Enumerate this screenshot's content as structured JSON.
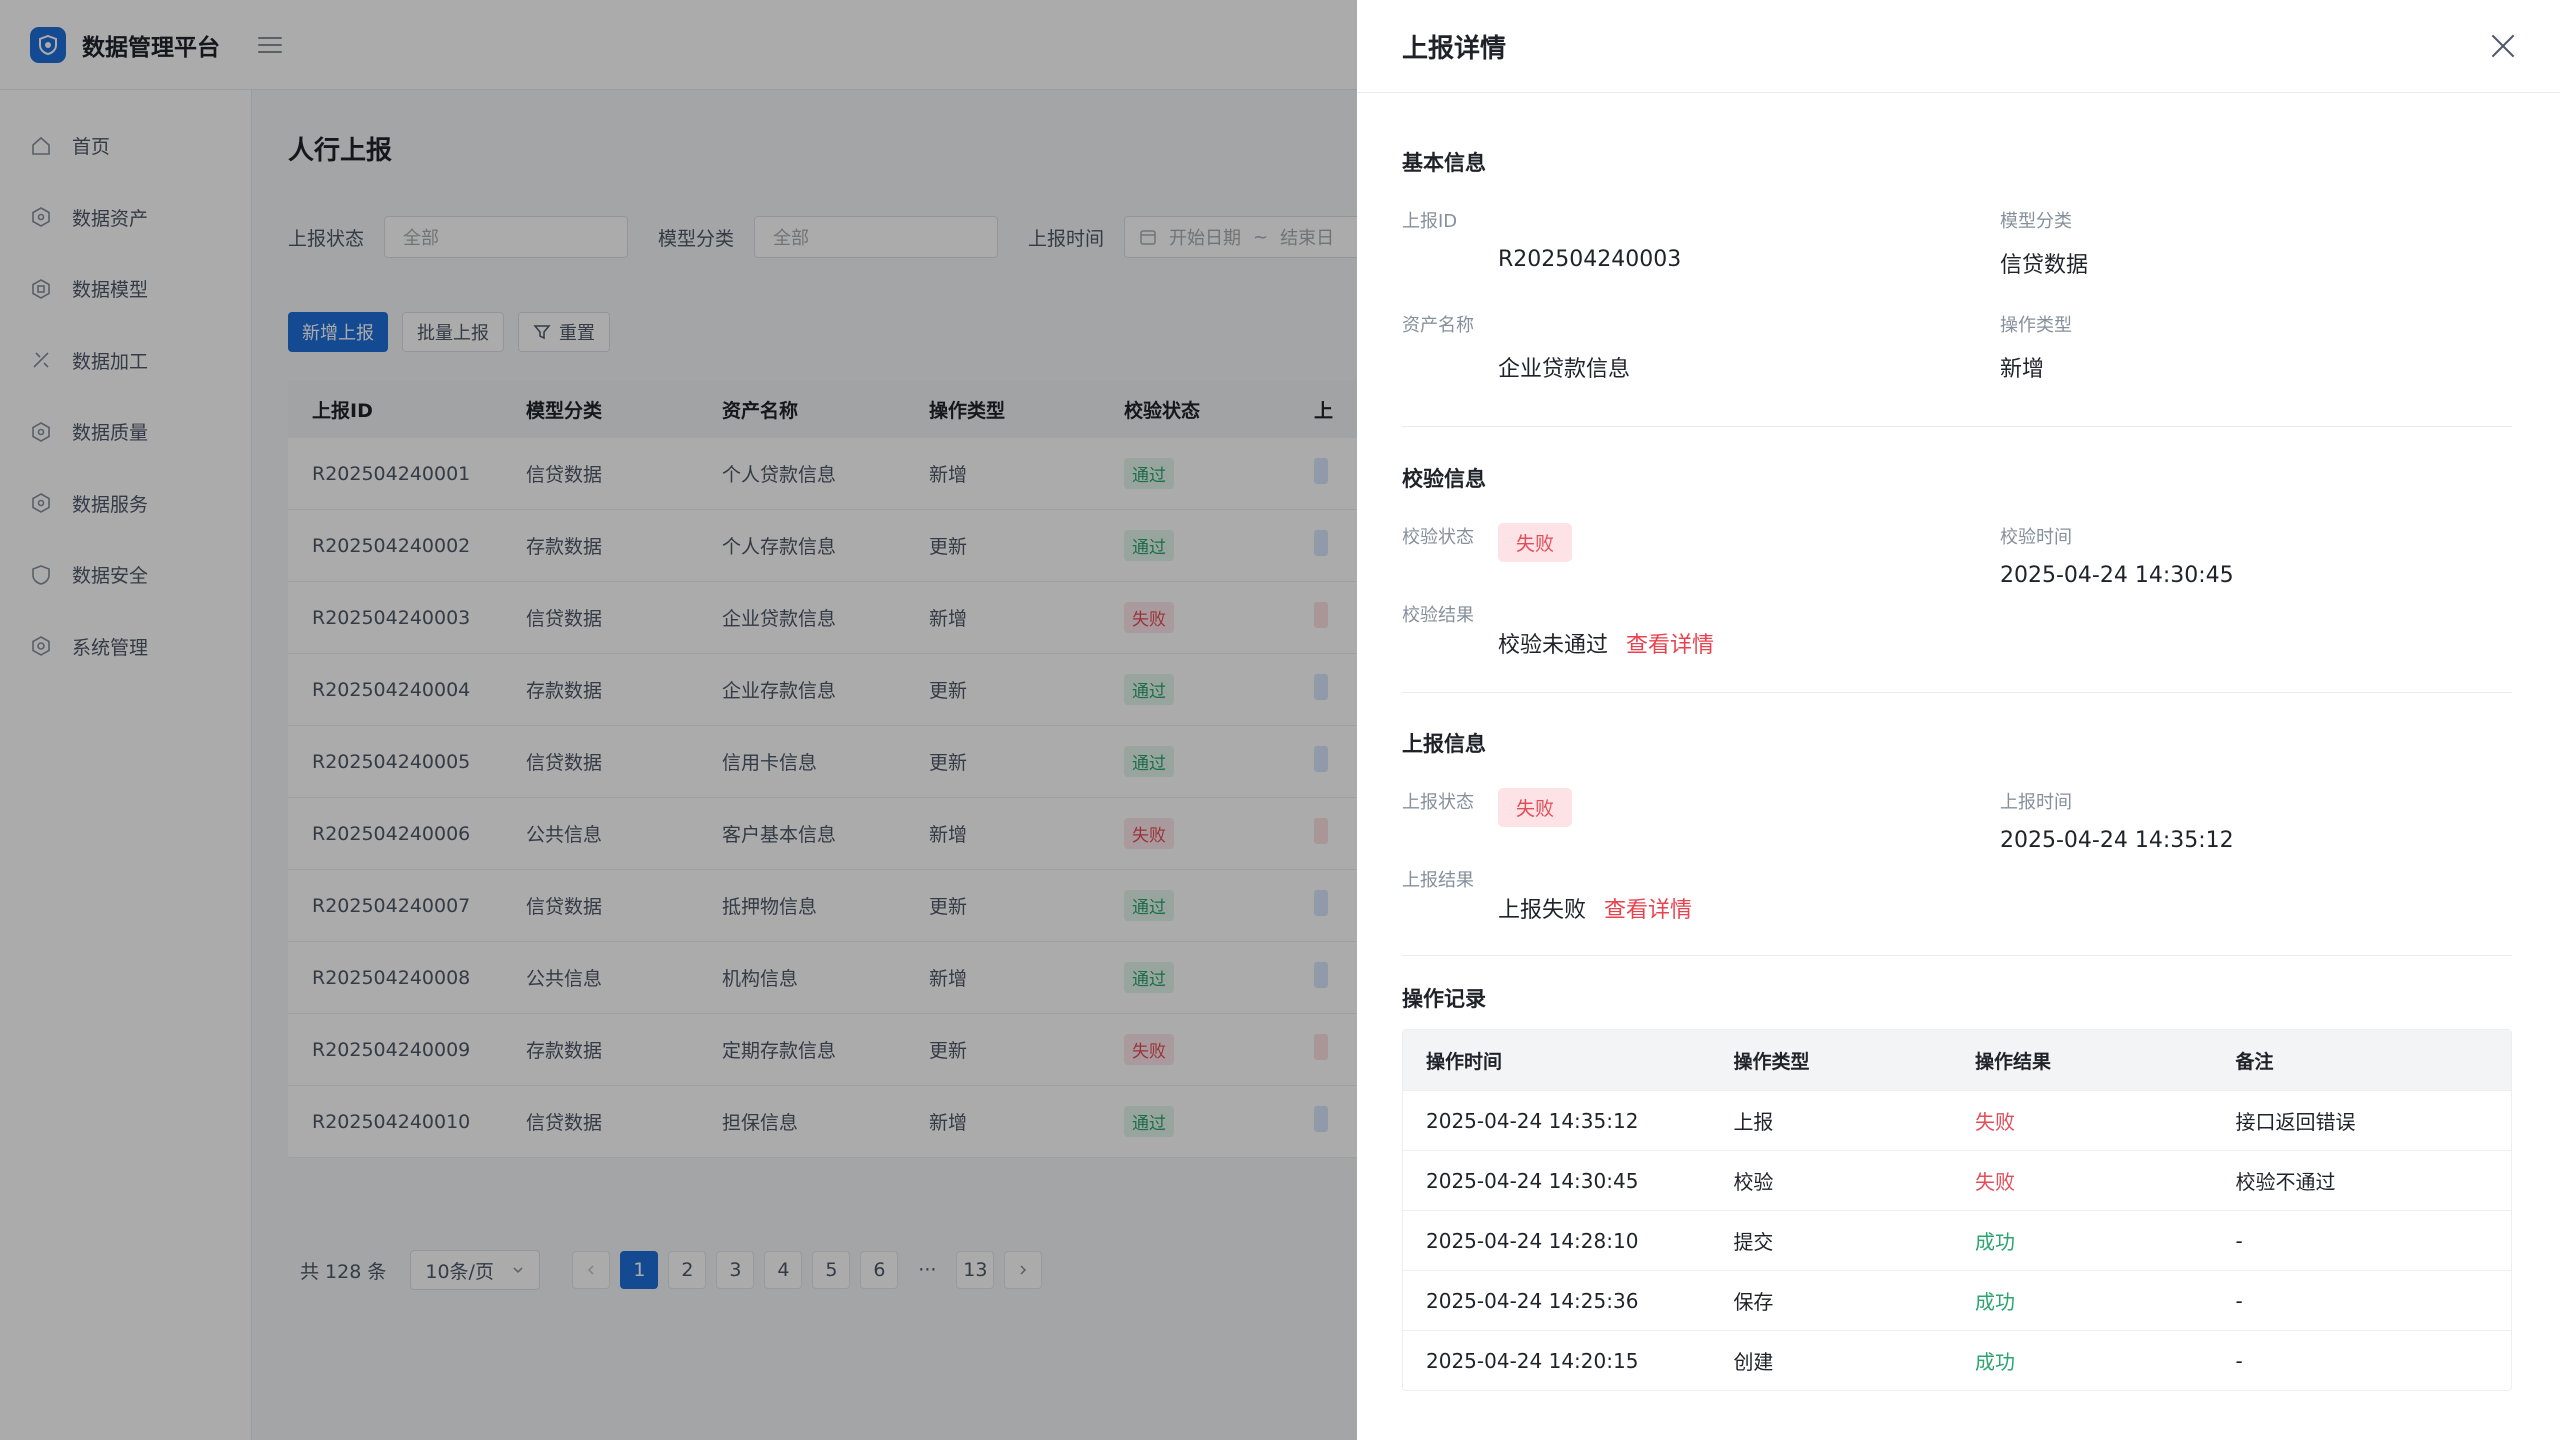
{
  "app": {
    "title": "数据管理平台"
  },
  "sidebar": {
    "items": [
      {
        "label": "首页",
        "icon": "home-icon"
      },
      {
        "label": "数据资产",
        "icon": "asset-icon"
      },
      {
        "label": "数据模型",
        "icon": "model-icon"
      },
      {
        "label": "数据加工",
        "icon": "process-icon"
      },
      {
        "label": "数据质量",
        "icon": "quality-icon"
      },
      {
        "label": "数据服务",
        "icon": "service-icon"
      },
      {
        "label": "数据安全",
        "icon": "security-icon"
      },
      {
        "label": "系统管理",
        "icon": "settings-icon"
      }
    ]
  },
  "page": {
    "title": "人行上报",
    "filters": {
      "status_label": "上报状态",
      "status_placeholder": "全部",
      "model_label": "模型分类",
      "model_placeholder": "全部",
      "time_label": "上报时间",
      "start_placeholder": "开始日期",
      "sep": "~",
      "end_placeholder": "结束日"
    },
    "actions": {
      "add": "新增上报",
      "batch": "批量上报",
      "reset": "重置"
    },
    "table": {
      "columns": [
        "上报ID",
        "模型分类",
        "资产名称",
        "操作类型",
        "校验状态",
        "上"
      ],
      "rows": [
        {
          "id": "R202504240001",
          "model": "信贷数据",
          "asset": "个人贷款信息",
          "op": "新增",
          "check": "通过"
        },
        {
          "id": "R202504240002",
          "model": "存款数据",
          "asset": "个人存款信息",
          "op": "更新",
          "check": "通过"
        },
        {
          "id": "R202504240003",
          "model": "信贷数据",
          "asset": "企业贷款信息",
          "op": "新增",
          "check": "失败"
        },
        {
          "id": "R202504240004",
          "model": "存款数据",
          "asset": "企业存款信息",
          "op": "更新",
          "check": "通过"
        },
        {
          "id": "R202504240005",
          "model": "信贷数据",
          "asset": "信用卡信息",
          "op": "更新",
          "check": "通过"
        },
        {
          "id": "R202504240006",
          "model": "公共信息",
          "asset": "客户基本信息",
          "op": "新增",
          "check": "失败"
        },
        {
          "id": "R202504240007",
          "model": "信贷数据",
          "asset": "抵押物信息",
          "op": "更新",
          "check": "通过"
        },
        {
          "id": "R202504240008",
          "model": "公共信息",
          "asset": "机构信息",
          "op": "新增",
          "check": "通过"
        },
        {
          "id": "R202504240009",
          "model": "存款数据",
          "asset": "定期存款信息",
          "op": "更新",
          "check": "失败"
        },
        {
          "id": "R202504240010",
          "model": "信贷数据",
          "asset": "担保信息",
          "op": "新增",
          "check": "通过"
        }
      ]
    },
    "pagination": {
      "total": "共 128 条",
      "page_size": "10条/页",
      "pages": [
        "1",
        "2",
        "3",
        "4",
        "5",
        "6",
        "···",
        "13"
      ],
      "current": "1"
    }
  },
  "drawer": {
    "title": "上报详情",
    "basic": {
      "title": "基本信息",
      "id_label": "上报ID",
      "id_value": "R202504240003",
      "model_label": "模型分类",
      "model_value": "信贷数据",
      "asset_label": "资产名称",
      "asset_value": "企业贷款信息",
      "op_label": "操作类型",
      "op_value": "新增"
    },
    "check": {
      "title": "校验信息",
      "status_label": "校验状态",
      "status_value": "失败",
      "time_label": "校验时间",
      "time_value": "2025-04-24 14:30:45",
      "result_label": "校验结果",
      "result_value": "校验未通过",
      "detail_link": "查看详情"
    },
    "report": {
      "title": "上报信息",
      "status_label": "上报状态",
      "status_value": "失败",
      "time_label": "上报时间",
      "time_value": "2025-04-24 14:35:12",
      "result_label": "上报结果",
      "result_value": "上报失败",
      "detail_link": "查看详情"
    },
    "records": {
      "title": "操作记录",
      "columns": [
        "操作时间",
        "操作类型",
        "操作结果",
        "备注"
      ],
      "rows": [
        {
          "time": "2025-04-24 14:35:12",
          "type": "上报",
          "result": "失败",
          "note": "接口返回错误"
        },
        {
          "time": "2025-04-24 14:30:45",
          "type": "校验",
          "result": "失败",
          "note": "校验不通过"
        },
        {
          "time": "2025-04-24 14:28:10",
          "type": "提交",
          "result": "成功",
          "note": "-"
        },
        {
          "time": "2025-04-24 14:25:36",
          "type": "保存",
          "result": "成功",
          "note": "-"
        },
        {
          "time": "2025-04-24 14:20:15",
          "type": "创建",
          "result": "成功",
          "note": "-"
        }
      ]
    }
  }
}
